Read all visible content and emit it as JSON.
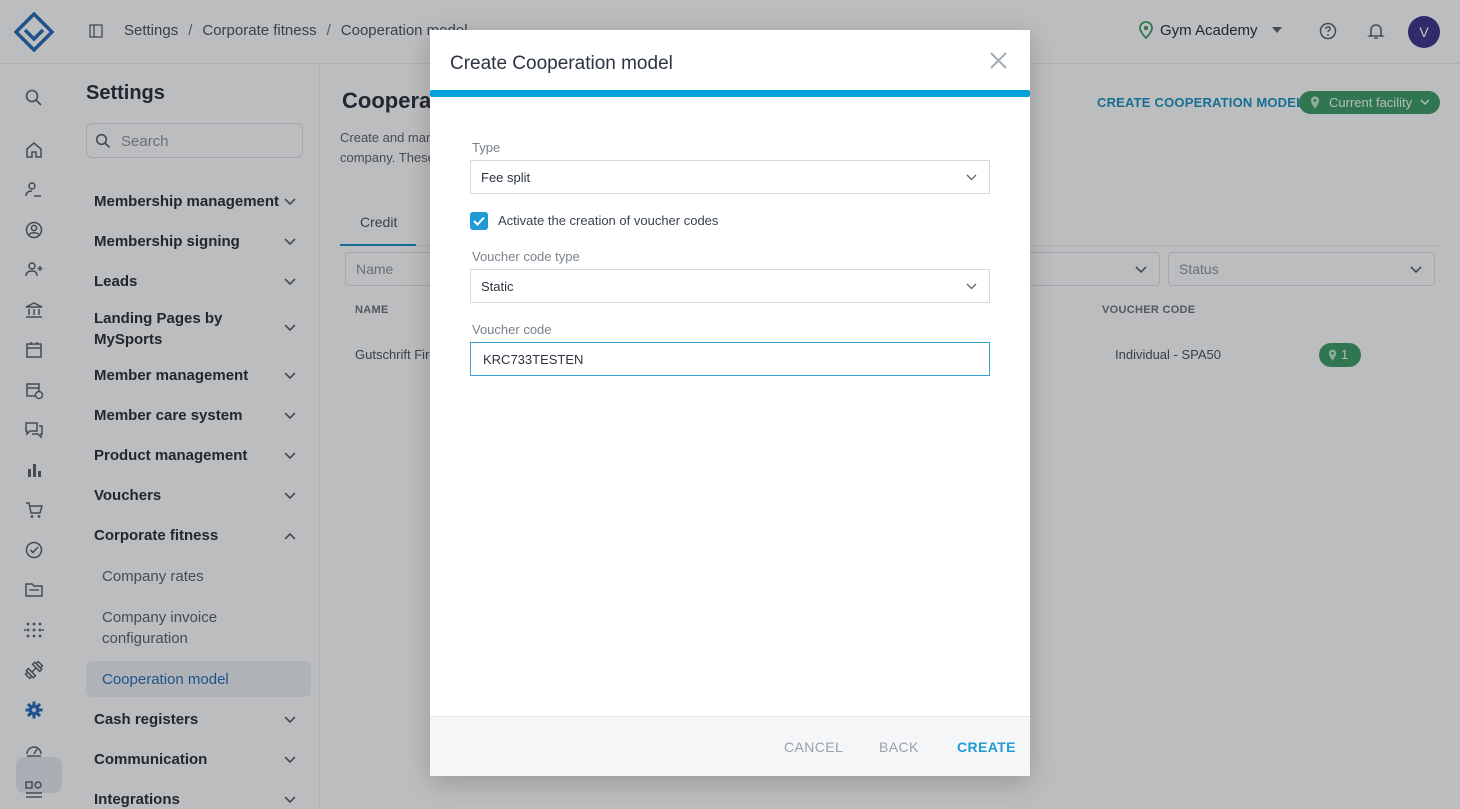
{
  "header": {
    "breadcrumb": [
      "Settings",
      "Corporate fitness",
      "Cooperation model"
    ],
    "facility": "Gym Academy",
    "avatar_initial": "V"
  },
  "rail": {
    "icons": [
      "search-icon",
      "home-icon",
      "user-sign-icon",
      "user-circle-icon",
      "user-add-icon",
      "bank-icon",
      "calendar-icon",
      "calendar-clock-icon",
      "chat-icon",
      "bar-chart-icon",
      "cart-icon",
      "check-circle-icon",
      "folder-icon",
      "dots-grid-icon",
      "dumbbell-icon",
      "settings-icon",
      "dashboard-icon",
      "grid-user-icon"
    ]
  },
  "sidebar": {
    "title": "Settings",
    "search_placeholder": "Search",
    "items": [
      {
        "label": "Membership management"
      },
      {
        "label": "Membership signing"
      },
      {
        "label": "Leads"
      },
      {
        "label": "Landing Pages by MySports"
      },
      {
        "label": "Member management"
      },
      {
        "label": "Member care system"
      },
      {
        "label": "Product management"
      },
      {
        "label": "Vouchers"
      },
      {
        "label": "Corporate fitness"
      },
      {
        "label": "Cash registers"
      },
      {
        "label": "Communication"
      },
      {
        "label": "Integrations"
      }
    ],
    "sub_items": [
      {
        "label": "Company rates"
      },
      {
        "label": "Company invoice configuration"
      },
      {
        "label": "Cooperation model"
      }
    ]
  },
  "main": {
    "title": "Cooperat",
    "description_line1": "Create and man",
    "description_line2": "company. These",
    "create_link": "CREATE COOPERATION MODEL",
    "facility_chip": "Current facility",
    "tab": "Credit",
    "filter_name_placeholder": "Name",
    "filter_status_placeholder": "Status",
    "columns": {
      "name": "NAME",
      "voucher_code": "VOUCHER CODE"
    },
    "row": {
      "name": "Gutschrift Fir",
      "voucher_code": "Individual - SPA50",
      "facility_count": "1"
    }
  },
  "modal": {
    "title": "Create Cooperation model",
    "type_label": "Type",
    "type_value": "Fee split",
    "checkbox_label": "Activate the creation of voucher codes",
    "checkbox_checked": true,
    "voucher_type_label": "Voucher code type",
    "voucher_type_value": "Static",
    "voucher_code_label": "Voucher code",
    "voucher_code_value": "KRC733TESTEN",
    "buttons": {
      "cancel": "CANCEL",
      "back": "BACK",
      "create": "CREATE"
    }
  },
  "colors": {
    "accent": "#1f9ad6",
    "progress_bar": "#00a0d8",
    "chip_green": "#3f9a6a",
    "avatar": "#3d3a8c"
  }
}
